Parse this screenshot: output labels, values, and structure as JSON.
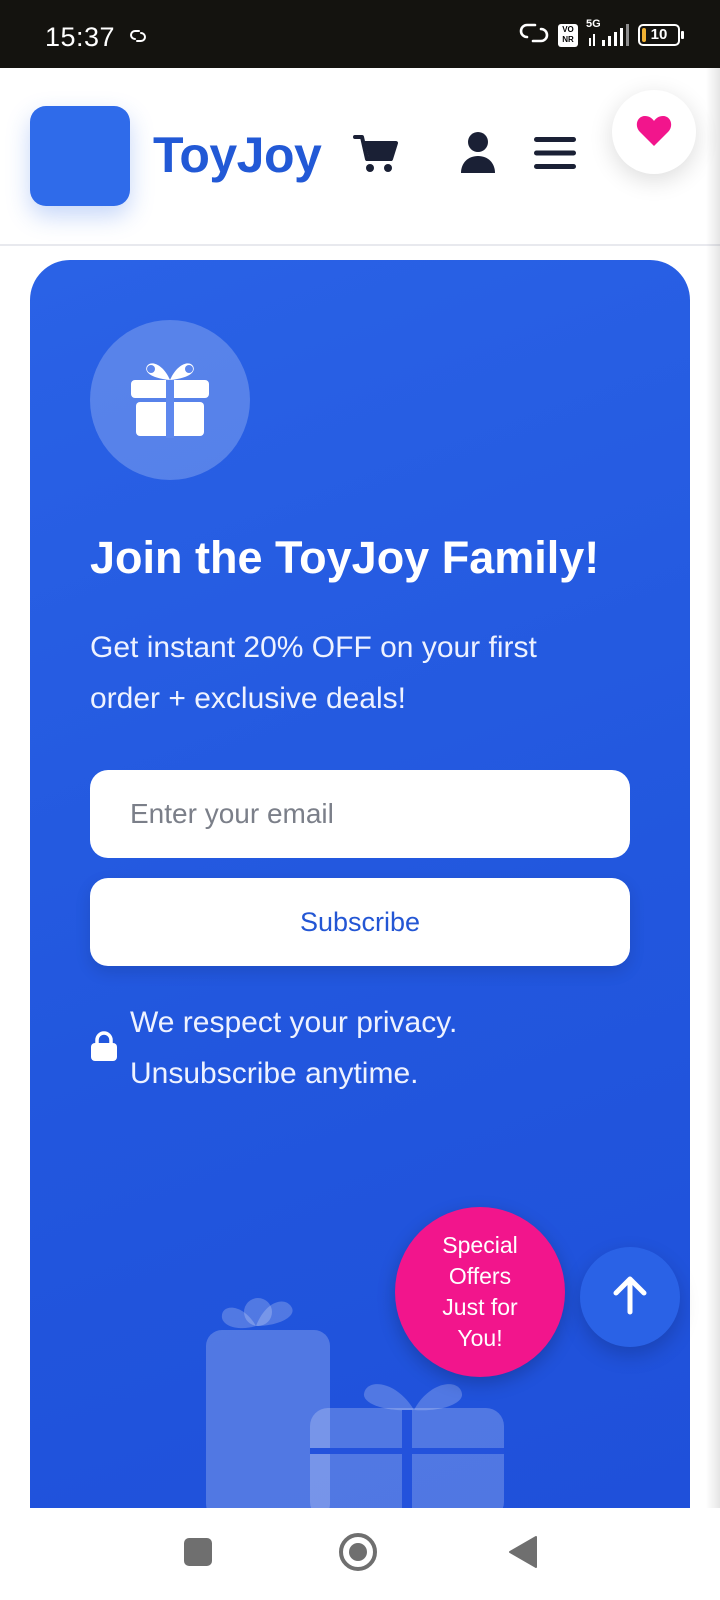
{
  "status_bar": {
    "time": "15:37",
    "network": "5G",
    "volte_badge": "VO NR",
    "battery": "10",
    "icons": [
      "link-icon",
      "hotspot-icon",
      "signal-icon",
      "battery-icon"
    ]
  },
  "header": {
    "brand": "ToyJoy",
    "icons": [
      "cart-icon",
      "user-icon",
      "menu-icon",
      "heart-icon"
    ],
    "colors": {
      "brand": "#2259d6",
      "logo": "#2f6bea",
      "heart": "#f2158c"
    }
  },
  "signup": {
    "title": "Join the ToyJoy Family!",
    "subtitle": "Get instant 20% OFF on your first order + exclusive deals!",
    "email_placeholder": "Enter your email",
    "subscribe_label": "Subscribe",
    "privacy_text": "We respect your privacy. Unsubscribe anytime.",
    "colors": {
      "card_bg": "#2257de"
    }
  },
  "floating": {
    "offers_label": "Special Offers Just for You!",
    "offers_color": "#f2158c",
    "back_to_top_icon": "arrow-up-icon"
  },
  "nav_bar": {
    "icons": [
      "recents-square-icon",
      "home-circle-icon",
      "back-triangle-icon"
    ]
  }
}
